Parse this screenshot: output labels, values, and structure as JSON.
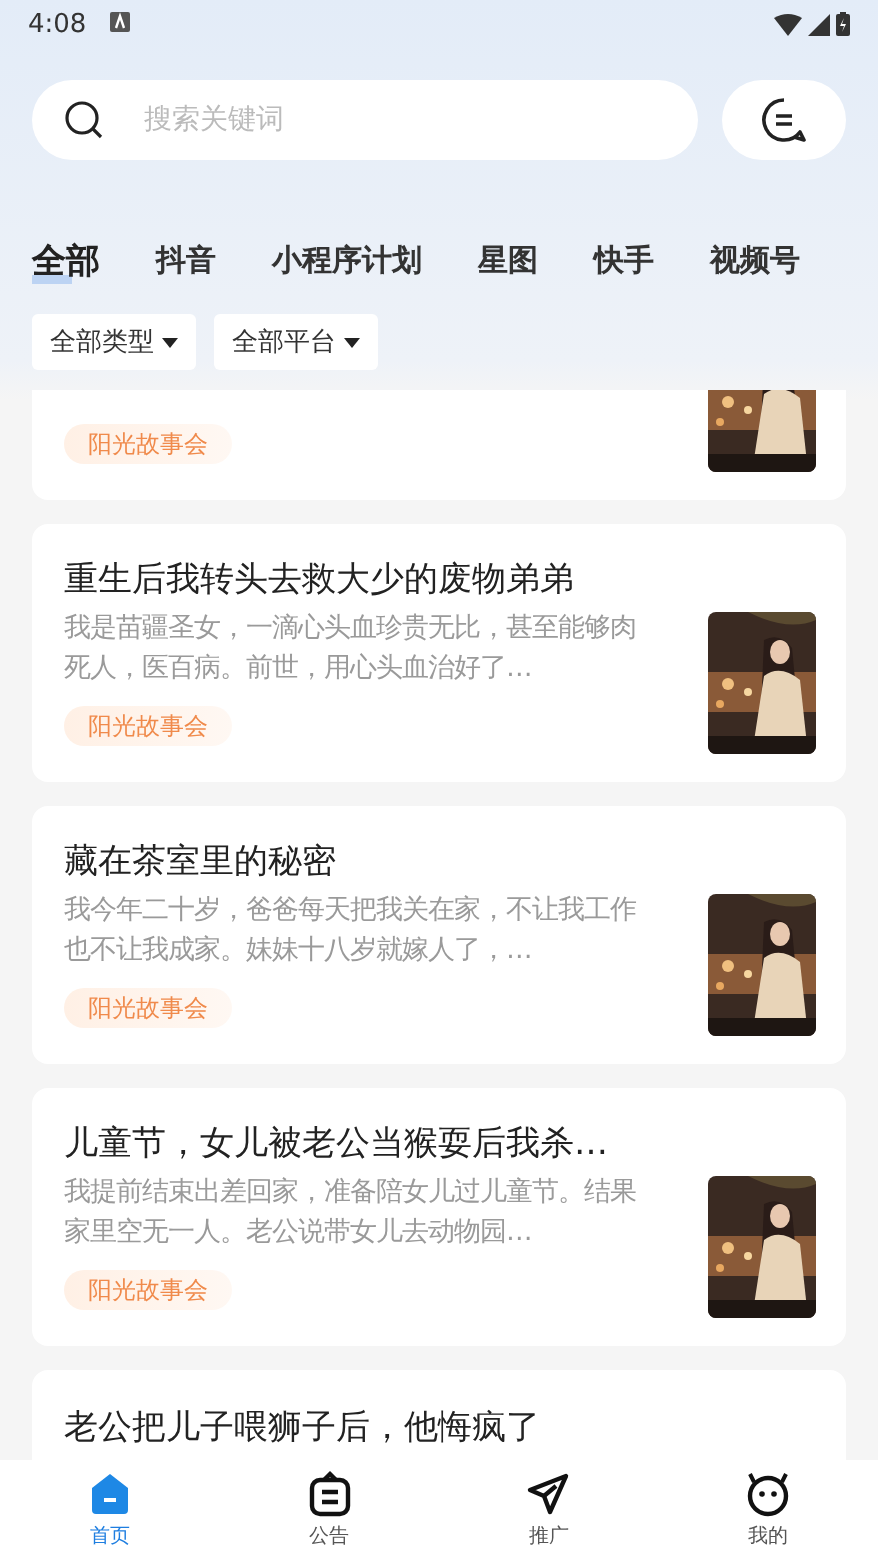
{
  "status_bar": {
    "time": "4:08"
  },
  "search": {
    "placeholder": "搜索关键词"
  },
  "categories": [
    {
      "label": "全部",
      "selected": true
    },
    {
      "label": "抖音",
      "selected": false
    },
    {
      "label": "小程序计划",
      "selected": false
    },
    {
      "label": "星图",
      "selected": false
    },
    {
      "label": "快手",
      "selected": false
    },
    {
      "label": "视频号",
      "selected": false
    }
  ],
  "filters": [
    {
      "label": "全部类型"
    },
    {
      "label": "全部平台"
    }
  ],
  "cards": [
    {
      "tag": "阳光故事会"
    },
    {
      "title": "重生后我转头去救大少的废物弟弟",
      "description": "我是苗疆圣女，一滴心头血珍贵无比，甚至能够肉死人，医百病。前世，用心头血治好了…",
      "tag": "阳光故事会"
    },
    {
      "title": "藏在茶室里的秘密",
      "description": "我今年二十岁，爸爸每天把我关在家，不让我工作也不让我成家。妹妹十八岁就嫁人了，…",
      "tag": "阳光故事会"
    },
    {
      "title": "儿童节，女儿被老公当猴耍后我杀…",
      "description": "我提前结束出差回家，准备陪女儿过儿童节。结果家里空无一人。老公说带女儿去动物园…",
      "tag": "阳光故事会"
    },
    {
      "title": "老公把儿子喂狮子后，他悔疯了"
    }
  ],
  "nav": [
    {
      "label": "首页",
      "selected": true
    },
    {
      "label": "公告",
      "selected": false
    },
    {
      "label": "推广",
      "selected": false
    },
    {
      "label": "我的",
      "selected": false
    }
  ]
}
